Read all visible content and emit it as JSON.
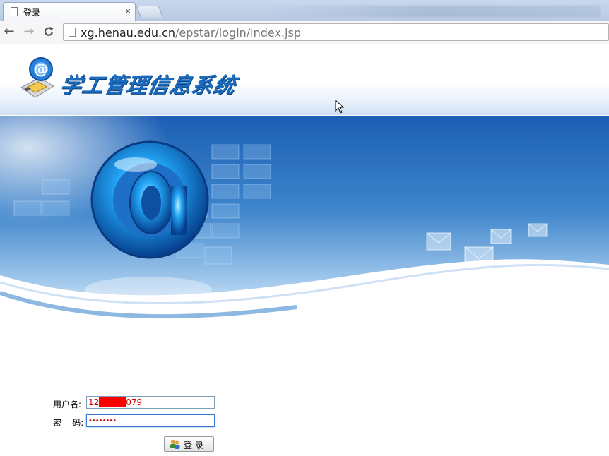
{
  "browser": {
    "tab_title": "登录",
    "tab_close": "×",
    "back_glyph": "←",
    "forward_glyph": "→",
    "reload_glyph": "C",
    "url_host": "xg.henau.edu.cn",
    "url_path": "/epstar/login/index.jsp"
  },
  "header": {
    "system_title": "学工管理信息系统",
    "logo_icon": "at-sign-disk-icon"
  },
  "login": {
    "username_label": "用户名:",
    "username_prefix": "12",
    "username_suffix": "079",
    "password_label": "密    码:",
    "password_mask": "••••••••",
    "submit_label": "登录"
  },
  "colors": {
    "title_blue": "#1a6bbd",
    "banner_blue": "#1d63b8",
    "field_text": "#cc0000",
    "redaction": "#ff0000"
  }
}
